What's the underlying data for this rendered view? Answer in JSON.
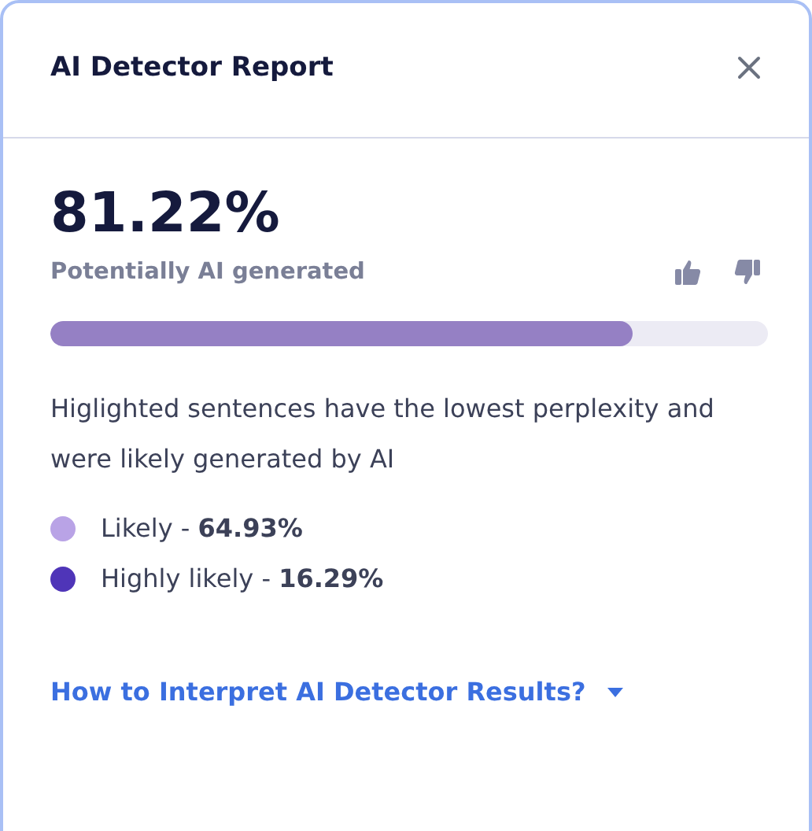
{
  "panel": {
    "title": "AI Detector Report"
  },
  "score": {
    "value": "81.22%",
    "label": "Potentially AI generated",
    "level": 0.8122
  },
  "description": "Higlighted sentences have the lowest perplexity and were likely generated by AI",
  "legend": [
    {
      "text": "Likely - **64.93%**",
      "color": "#b9a3e6"
    },
    {
      "text": "Highly likely - **16.29%**",
      "color": "#4f35b8"
    }
  ],
  "help_link": {
    "label": "How to Interpret AI Detector Results?"
  }
}
